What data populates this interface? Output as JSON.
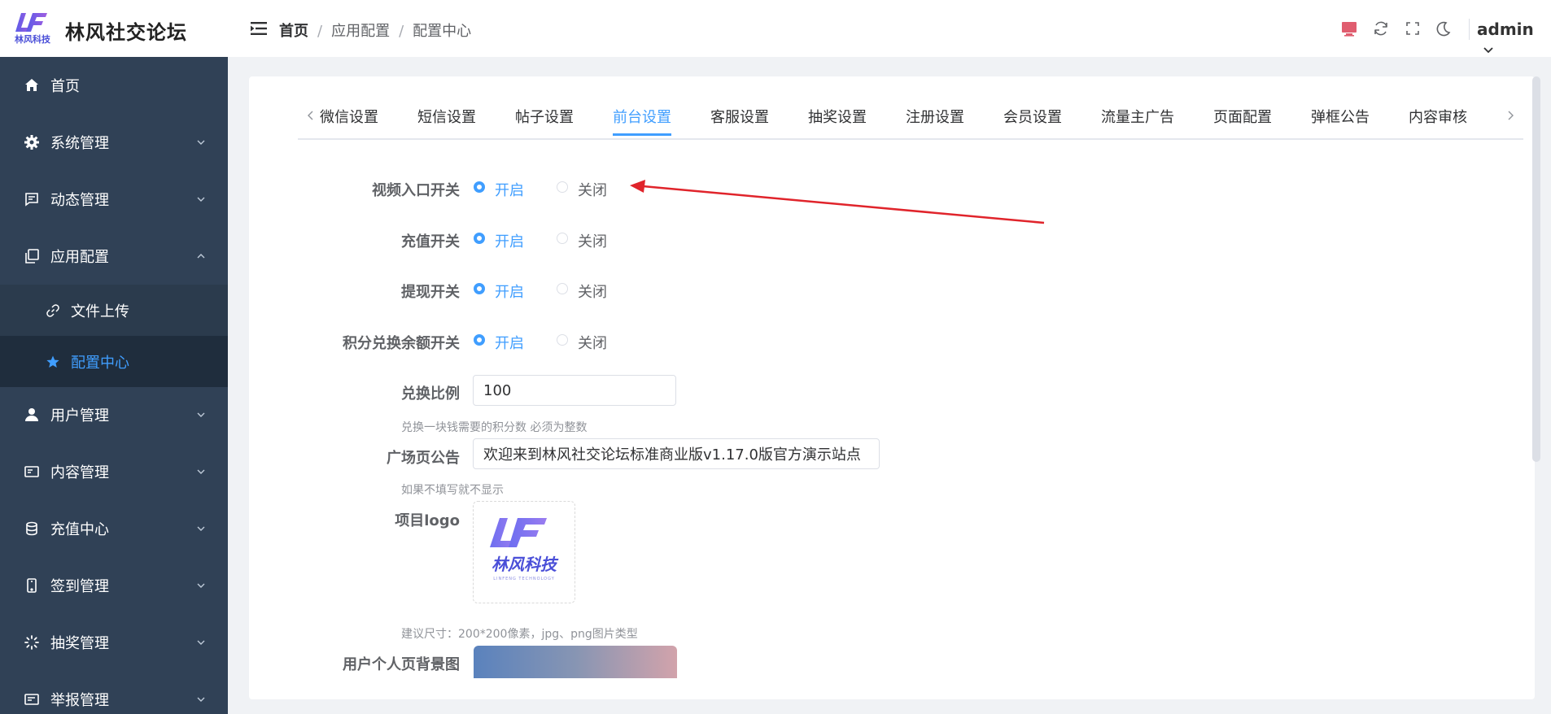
{
  "app": {
    "logo_text": "林风科技",
    "title": "林风社交论坛"
  },
  "breadcrumb": [
    "首页",
    "应用配置",
    "配置中心"
  ],
  "header": {
    "user": "admin",
    "tools": [
      "screen-icon",
      "refresh-icon",
      "fullscreen-icon",
      "moon-icon"
    ]
  },
  "sidebar": {
    "items": [
      {
        "label": "首页",
        "icon": "home-icon"
      },
      {
        "label": "系统管理",
        "icon": "gear-icon"
      },
      {
        "label": "动态管理",
        "icon": "message-icon"
      },
      {
        "label": "应用配置",
        "icon": "copy-icon",
        "expanded": true
      },
      {
        "label": "用户管理",
        "icon": "user-icon"
      },
      {
        "label": "内容管理",
        "icon": "card-icon"
      },
      {
        "label": "充值中心",
        "icon": "coins-icon"
      },
      {
        "label": "签到管理",
        "icon": "phone-icon"
      },
      {
        "label": "抽奖管理",
        "icon": "loading-icon"
      },
      {
        "label": "举报管理",
        "icon": "report-icon"
      }
    ],
    "sub_items": [
      {
        "label": "文件上传",
        "icon": "link-icon"
      },
      {
        "label": "配置中心",
        "icon": "star-icon",
        "active": true
      }
    ]
  },
  "tabs": [
    "微信设置",
    "短信设置",
    "帖子设置",
    "前台设置",
    "客服设置",
    "抽奖设置",
    "注册设置",
    "会员设置",
    "流量主广告",
    "页面配置",
    "弹框公告",
    "内容审核"
  ],
  "active_tab": "前台设置",
  "form": {
    "switches": [
      {
        "label": "视频入口开关",
        "value": "开启"
      },
      {
        "label": "充值开关",
        "value": "开启"
      },
      {
        "label": "提现开关",
        "value": "开启"
      },
      {
        "label": "积分兑换余额开关",
        "value": "开启"
      }
    ],
    "on_label": "开启",
    "off_label": "关闭",
    "exchange": {
      "label": "兑换比例",
      "value": "100",
      "hint": "兑换一块钱需要的积分数 必须为整数"
    },
    "notice": {
      "label": "广场页公告",
      "value": "欢迎来到林风社交论坛标准商业版v1.17.0版官方演示站点",
      "hint": "如果不填写就不显示"
    },
    "logo": {
      "label": "项目logo",
      "brand_text": "林风科技",
      "brand_sub": "LINFENG TECHNOLOGY",
      "hint": "建议尺寸：200*200像素，jpg、png图片类型"
    },
    "bg_image": {
      "label": "用户个人页背景图"
    }
  },
  "colors": {
    "sidebar_bg": "#304156",
    "sidebar_sub_bg": "#2b3b4d",
    "sidebar_active_bg": "#1f2d3d",
    "primary": "#409eff",
    "logo_blue": "#4a4fd8",
    "annotation_red": "#e0242b"
  }
}
